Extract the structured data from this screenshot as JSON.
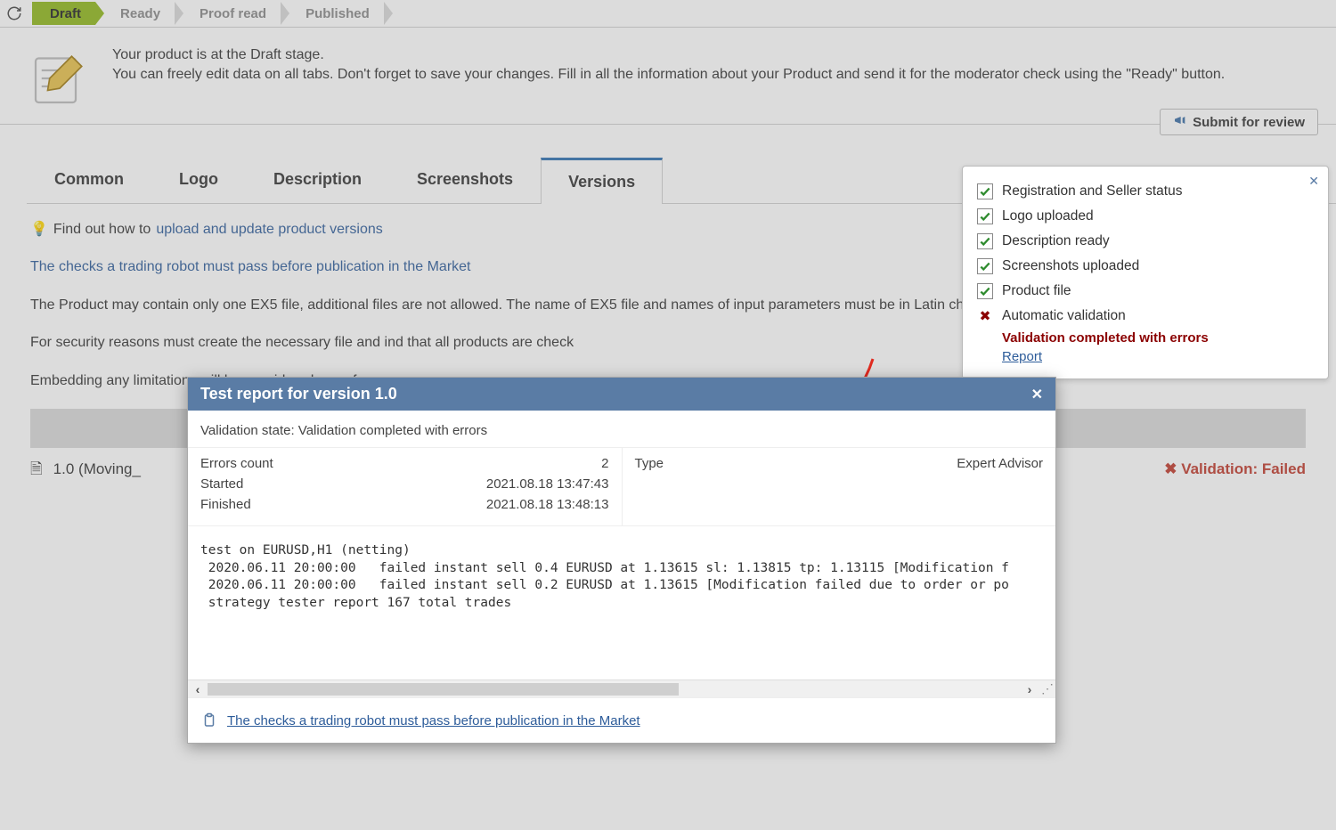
{
  "stages": {
    "s0": "Draft",
    "s1": "Ready",
    "s2": "Proof read",
    "s3": "Published"
  },
  "info": {
    "line1": "Your product is at the Draft stage.",
    "line2": "You can freely edit data on all tabs. Don't forget to save your changes. Fill in all the information about your Product and send it for the moderator check using the \"Ready\" button."
  },
  "submit_label": "Submit for review",
  "tabs": {
    "t0": "Common",
    "t1": "Logo",
    "t2": "Description",
    "t3": "Screenshots",
    "t4": "Versions"
  },
  "hint_prefix": "Find out how to ",
  "hint_link": "upload and update product versions",
  "checks_link": "The checks a trading robot must pass before publication in the Market",
  "body_p1": "The Product may contain only one EX5 file, additional files are not allowed. The name of EX5 file and names of input parameters must be in Latin characters. T",
  "body_p2": "For security reasons must create the necessary file and ind that all products are check",
  "body_p3": "Embedding any limitations will be considered as unfr",
  "version_row": {
    "label": "1.0 (Moving_",
    "status": "Validation: Failed"
  },
  "checklist": {
    "c0": "Registration and Seller status",
    "c1": "Logo uploaded",
    "c2": "Description ready",
    "c3": "Screenshots uploaded",
    "c4": "Product file",
    "c5": "Automatic validation",
    "err": "Validation completed with errors",
    "report": "Report"
  },
  "modal": {
    "title": "Test report for version 1.0",
    "state_label": "Validation state: ",
    "state_value": "Validation completed with errors",
    "errors_label": "Errors count",
    "errors_value": "2",
    "started_label": "Started",
    "started_value": "2021.08.18 13:47:43",
    "finished_label": "Finished",
    "finished_value": "2021.08.18 13:48:13",
    "type_label": "Type",
    "type_value": "Expert Advisor",
    "log": "test on EURUSD,H1 (netting)\n 2020.06.11 20:00:00   failed instant sell 0.4 EURUSD at 1.13615 sl: 1.13815 tp: 1.13115 [Modification f\n 2020.06.11 20:00:00   failed instant sell 0.2 EURUSD at 1.13615 [Modification failed due to order or po\n strategy tester report 167 total trades",
    "footer_link": "The checks a trading robot must pass before publication in the Market"
  }
}
